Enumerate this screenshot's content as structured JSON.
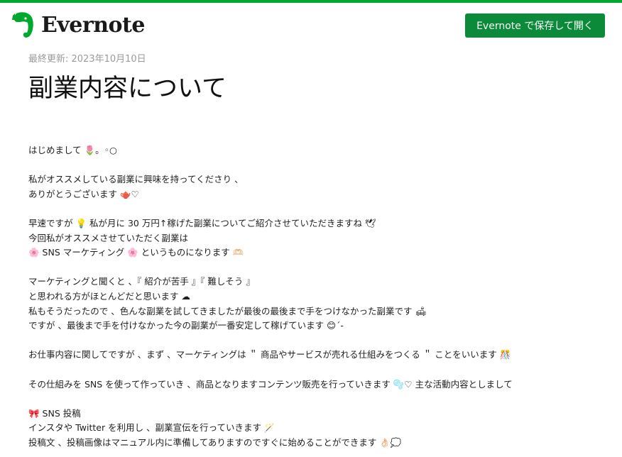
{
  "header": {
    "logo_text": "Evernote",
    "save_button_label": "Evernote で保存して開く",
    "brand_color": "#00a82d",
    "button_color": "#0b8b39"
  },
  "note": {
    "last_updated": "最終更新: 2023年10月10日",
    "title": "副業内容について",
    "lines": [
      "はじめまして 🌷。◦○",
      "",
      "私がオススメしている副業に興味を持ってくださり 、",
      "ありがとうございます 🫖♡",
      "",
      "早速ですが 💡 私が月に 30 万円↑稼げた副業についてご紹介させていただきますね 🕊",
      "今回私がオススメさせていただく副業は",
      "🌸 SNS マーケティング 🌸 というものになります 🫶🏻",
      "",
      "マーケティングと聞くと 、『 紹介が苦手 』『 難しそう 』",
      "と思われる方がほとんどだと思います ☁",
      "私もそうだったので 、色んな副業を試してきましたが最後の最後まで手をつけなかった副業です 🛋",
      "ですが 、最後まで手を付けなかった今の副業が一番安定して稼げています 😊´-",
      "",
      "お仕事内容に関してですが 、まず 、マーケティングは ＂ 商品やサービスが売れる仕組みをつくる ＂ ことをいいます 🎊",
      "",
      "その仕組みを SNS を使って作っていき 、商品となりますコンテンツ販売を行っていきます 🫧♡ 主な活動内容としまして",
      "",
      "🎀 SNS 投稿",
      "インスタや Twitter を利用し 、副業宣伝を行っていきます 🪄",
      "投稿文 、投稿画像はマニュアル内に準備してありますのですぐに始めることができます 👌🏻💭"
    ]
  }
}
